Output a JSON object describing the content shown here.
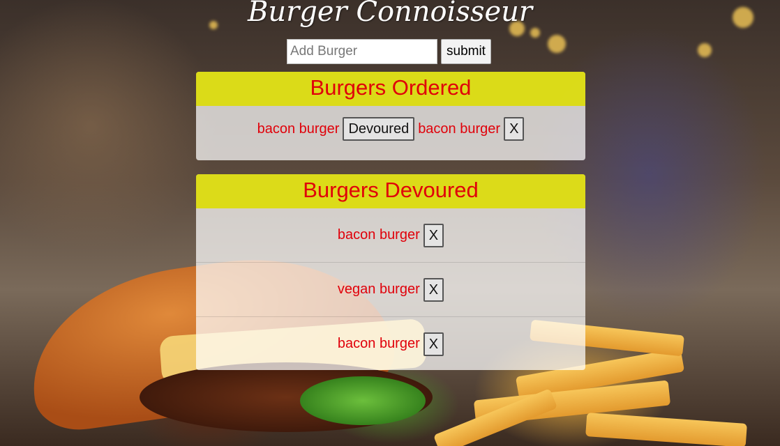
{
  "header": {
    "title": "Burger Connoisseur"
  },
  "add_form": {
    "placeholder": "Add Burger",
    "value": "",
    "submit_label": "submit"
  },
  "ordered": {
    "title": "Burgers Ordered",
    "items": [
      {
        "name": "bacon burger",
        "button": "Devoured"
      },
      {
        "name": "bacon burger",
        "button": "X"
      }
    ]
  },
  "devoured": {
    "title": "Burgers Devoured",
    "items": [
      {
        "name": "bacon burger",
        "button": "X"
      },
      {
        "name": "vegan burger",
        "button": "X"
      },
      {
        "name": "bacon burger",
        "button": "X"
      }
    ]
  },
  "colors": {
    "header_bg": "#dddd00",
    "item_text": "#e0000a",
    "title_text": "#ffffff"
  },
  "icons": {
    "background": "burger-photo"
  }
}
